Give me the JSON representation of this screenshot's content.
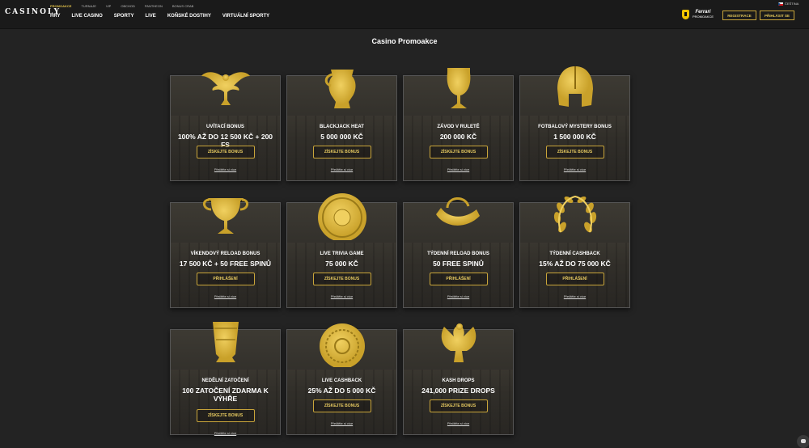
{
  "header": {
    "logo": "CASINOLY",
    "subnav": [
      {
        "label": "PROMOAKCE",
        "active": true
      },
      {
        "label": "TURNAJE",
        "active": false
      },
      {
        "label": "VIP",
        "active": false
      },
      {
        "label": "OBCHOD",
        "active": false
      },
      {
        "label": "PANTHEON",
        "active": false
      },
      {
        "label": "BONUS CRAB",
        "active": false
      }
    ],
    "mainnav": [
      "HRY",
      "LIVE CASINO",
      "SPORTY",
      "LIVE",
      "KOŇSKÉ DOSTIHY",
      "VIRTUÁLNÍ SPORTY"
    ],
    "brand_line1": "Ferrari",
    "brand_line2": "PROMOAKCE",
    "language": "ČEŠTINA",
    "register_label": "REGISTRACE",
    "login_label": "PŘIHLÁSIT SE"
  },
  "page_title": "Casino Promoakce",
  "promotions": [
    {
      "title": "UVÍTACÍ BONUS",
      "value": "100% AŽ DO 12 500 KČ + 200 FS",
      "cta": "ZÍSKEJTE BONUS",
      "terms": "Přečtěte si více",
      "art": "eagle-icon"
    },
    {
      "title": "BLACKJACK HEAT",
      "value": "5 000 000 KČ",
      "cta": "ZÍSKEJTE BONUS",
      "terms": "Přečtěte si více",
      "art": "vase-icon"
    },
    {
      "title": "ZÁVOD V RULETĚ",
      "value": "200 000 KČ",
      "cta": "ZÍSKEJTE BONUS",
      "terms": "Přečtěte si více",
      "art": "goblet-icon"
    },
    {
      "title": "FOTBALOVÝ MYSTERY BONUS",
      "value": "1 500 000 KČ",
      "cta": "ZÍSKEJTE BONUS",
      "terms": "Přečtěte si více",
      "art": "helmet-icon"
    },
    {
      "title": "VÍKENDOVÝ RELOAD BONUS",
      "value": "17 500 KČ + 50 FREE SPINŮ",
      "cta": "PŘIHLÁŠENÍ",
      "terms": "Přečtěte si více",
      "art": "chalice-icon"
    },
    {
      "title": "LIVE TRIVIA GAME",
      "value": "75 000 KČ",
      "cta": "ZÍSKEJTE BONUS",
      "terms": "Přečtěte si více",
      "art": "shield-icon"
    },
    {
      "title": "TÝDENNÍ RELOAD BONUS",
      "value": "50 FREE SPINŮ",
      "cta": "PŘIHLÁŠENÍ",
      "terms": "Přečtěte si více",
      "art": "horn-icon"
    },
    {
      "title": "TÝDENNÍ CASHBACK",
      "value": "15% AŽ DO 75 000 KČ",
      "cta": "PŘIHLÁŠENÍ",
      "terms": "Přečtěte si více",
      "art": "laurel-icon"
    },
    {
      "title": "NEDĚLNÍ ZATOČENÍ",
      "value": "100 ZATOČENÍ ZDARMA K VÝHŘE",
      "cta": "ZÍSKEJTE BONUS",
      "terms": "Přečtěte si více",
      "art": "cup-icon"
    },
    {
      "title": "LIVE CASHBACK",
      "value": "25% AŽ DO 5 000 KČ",
      "cta": "ZÍSKEJTE BONUS",
      "terms": "Přečtěte si více",
      "art": "coin-icon"
    },
    {
      "title": "KASH DROPS",
      "value": "241,000 PRIZE DROPS",
      "cta": "ZÍSKEJTE BONUS",
      "terms": "Přečtěte si více",
      "art": "eagle-standard-icon"
    }
  ]
}
